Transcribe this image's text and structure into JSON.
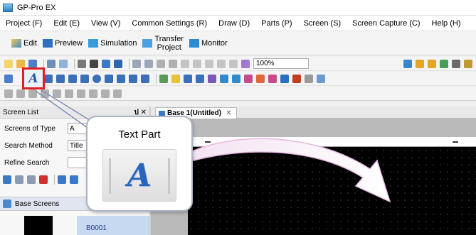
{
  "window": {
    "title": "GP-Pro EX"
  },
  "menu": [
    "Project (F)",
    "Edit (E)",
    "View (V)",
    "Common Settings (R)",
    "Draw (D)",
    "Parts (P)",
    "Screen (S)",
    "Screen Capture (C)",
    "Help (H)"
  ],
  "modes": {
    "edit": "Edit",
    "preview": "Preview",
    "simulation": "Simulation",
    "transfer_line1": "Transfer",
    "transfer_line2": "Project",
    "monitor": "Monitor"
  },
  "toolbar": {
    "zoom": "100%"
  },
  "text_tool": {
    "glyph": "A"
  },
  "screen_list": {
    "title": "Screen List",
    "pin": "ป",
    "close": "✕",
    "fields": [
      {
        "label": "Screens of Type",
        "value": "A"
      },
      {
        "label": "Search Method",
        "value": "Title"
      },
      {
        "label": "Refine Search",
        "value": ""
      }
    ],
    "base_screens": "Base Screens",
    "thumb_label": "B0001"
  },
  "editor": {
    "tab": "Base 1(Untitled)",
    "tab_close": "✕"
  },
  "callout": {
    "title": "Text Part",
    "glyph": "A"
  },
  "colors": {
    "highlight": "#e21f1f",
    "callout_border": "#aab4c6",
    "canvas": "#000000",
    "accent_blue": "#2a64b8"
  }
}
